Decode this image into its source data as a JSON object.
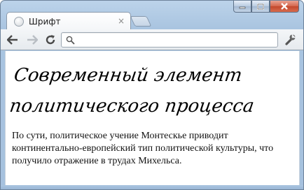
{
  "browser": {
    "tab": {
      "title": "Шрифт",
      "close_glyph": "×",
      "favicon": "globe-icon"
    },
    "toolbar": {
      "back_icon": "arrow-left-icon",
      "forward_icon": "arrow-right-icon",
      "reload_icon": "reload-icon",
      "omnibox_value": "",
      "omnibox_icon": "search-icon",
      "menu_icon": "wrench-icon"
    },
    "window_controls": [
      "minimize-icon",
      "maximize-icon",
      "close-icon"
    ]
  },
  "page": {
    "heading": "Современный элемент политического процесса",
    "paragraph": "По сути, политическое учение Монтескье приводит континентально-европейский тип политической культуры, что получило отражение в трудах Михельса."
  }
}
